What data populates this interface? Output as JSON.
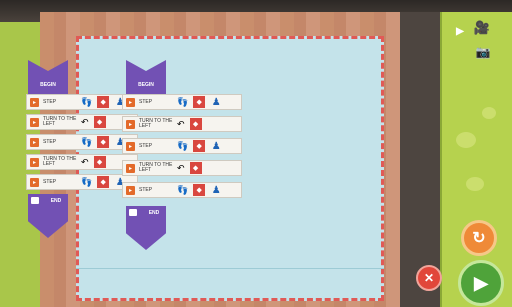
{
  "toolbar": {
    "icons": [
      "play-icon",
      "movie-camera-icon",
      "photo-camera-icon"
    ]
  },
  "program_left": {
    "begin_label": "BEGIN",
    "end_label": "END",
    "steps": [
      {
        "label": "STEP",
        "glyph": "footprints-icon"
      },
      {
        "label": "TURN TO THE LEFT",
        "glyph": "turn-left-arrow-icon"
      },
      {
        "label": "STEP",
        "glyph": "footprints-icon"
      },
      {
        "label": "TURN TO THE LEFT",
        "glyph": "turn-left-arrow-icon"
      },
      {
        "label": "STEP",
        "glyph": "footprints-icon"
      }
    ]
  },
  "program_right": {
    "begin_label": "BEGIN",
    "end_label": "END",
    "steps": [
      {
        "label": "STEP",
        "glyph": "footprints-icon"
      },
      {
        "label": "TURN TO THE LEFT",
        "glyph": "turn-left-arrow-icon"
      },
      {
        "label": "STEP",
        "glyph": "footprints-icon"
      },
      {
        "label": "TURN TO THE LEFT",
        "glyph": "turn-left-arrow-icon"
      },
      {
        "label": "STEP",
        "glyph": "footprints-icon"
      }
    ]
  },
  "controls": {
    "undo_glyph": "↻",
    "close_glyph": "✕",
    "run_glyph": "▶"
  },
  "colors": {
    "accent_green": "#b6d24e",
    "block_purple": "#7251b4",
    "sheet_blue": "#c4e3ea",
    "border_red": "#e05a56",
    "run_green": "#4fa33a",
    "undo_orange": "#ef8a38",
    "close_red": "#e1463a"
  }
}
